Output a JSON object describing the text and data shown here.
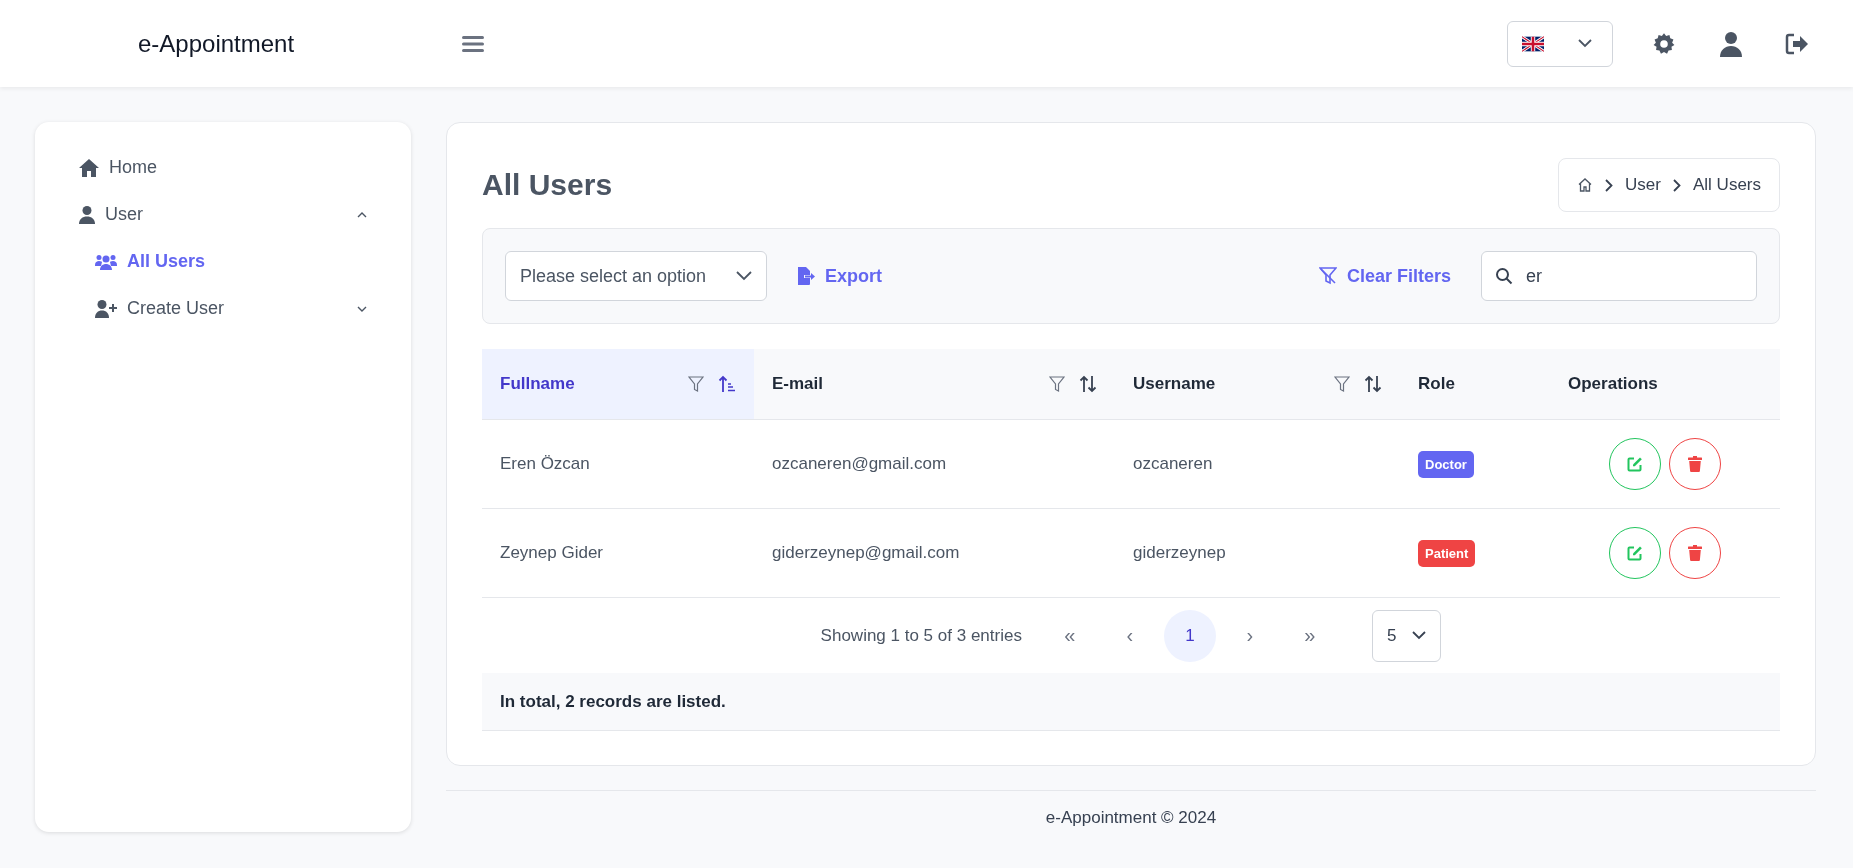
{
  "header": {
    "brand": "e-Appointment"
  },
  "sidebar": {
    "items": [
      {
        "label": "Home",
        "selected": false
      },
      {
        "label": "User",
        "expanded": true,
        "selected": false,
        "children": [
          {
            "label": "All Users",
            "selected": true
          },
          {
            "label": "Create User",
            "expanded": false,
            "selected": false
          }
        ]
      }
    ]
  },
  "page": {
    "title": "All Users",
    "breadcrumb": [
      "User",
      "All Users"
    ]
  },
  "toolbar": {
    "select_placeholder": "Please select an option",
    "export": "Export",
    "clear_filters": "Clear Filters",
    "search_value": "er"
  },
  "table": {
    "columns": [
      {
        "label": "Fullname",
        "filterable": true,
        "sortable": true,
        "sorted": true
      },
      {
        "label": "E-mail",
        "filterable": true,
        "sortable": true,
        "sorted": false
      },
      {
        "label": "Username",
        "filterable": true,
        "sortable": true,
        "sorted": false
      },
      {
        "label": "Role",
        "filterable": false,
        "sortable": false,
        "sorted": false
      },
      {
        "label": "Operations",
        "filterable": false,
        "sortable": false,
        "sorted": false
      }
    ],
    "rows": [
      {
        "fullname": "Eren Özcan",
        "email": "ozcaneren@gmail.com",
        "username": "ozcaneren",
        "role": "Doctor",
        "color": "#6366f1"
      },
      {
        "fullname": "Zeynep Gider",
        "email": "giderzeynep@gmail.com",
        "username": "giderzeynep",
        "role": "Patient",
        "color": "#ef4444"
      }
    ],
    "pagination": {
      "summary": "Showing 1 to 5 of 3 entries",
      "first": "«",
      "prev": "‹",
      "pages": [
        {
          "label": "1",
          "selected": true
        }
      ],
      "next": "›",
      "last": "»",
      "page_size": "5"
    },
    "total": "In total, 2 records are listed."
  },
  "footer": "e-Appointment © 2024"
}
